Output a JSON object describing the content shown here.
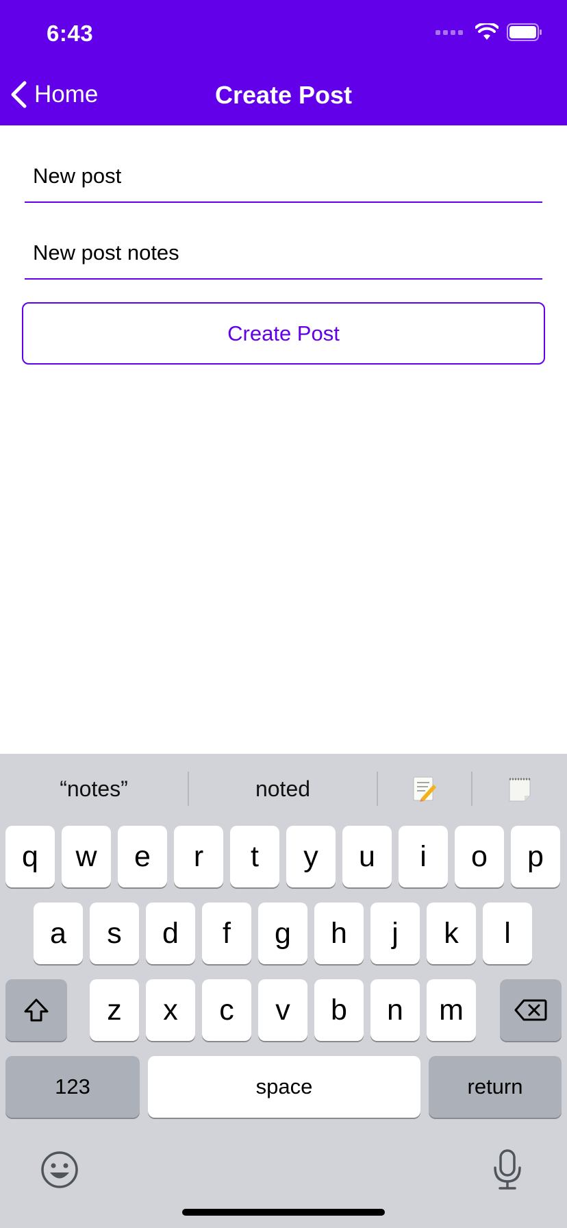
{
  "status": {
    "time": "6:43"
  },
  "nav": {
    "back_label": "Home",
    "title": "Create Post"
  },
  "form": {
    "title_value": "New post",
    "notes_value": "New post notes",
    "submit_label": "Create Post"
  },
  "keyboard": {
    "suggestions": [
      "“notes”",
      "noted"
    ],
    "suggestion_icons": [
      "memo-emoji-icon",
      "notepad-emoji-icon"
    ],
    "row1": [
      "q",
      "w",
      "e",
      "r",
      "t",
      "y",
      "u",
      "i",
      "o",
      "p"
    ],
    "row2": [
      "a",
      "s",
      "d",
      "f",
      "g",
      "h",
      "j",
      "k",
      "l"
    ],
    "row3": [
      "z",
      "x",
      "c",
      "v",
      "b",
      "n",
      "m"
    ],
    "numbers_label": "123",
    "space_label": "space",
    "return_label": "return"
  },
  "colors": {
    "accent": "#6200ea",
    "keyboard_bg": "#d1d3d9"
  }
}
